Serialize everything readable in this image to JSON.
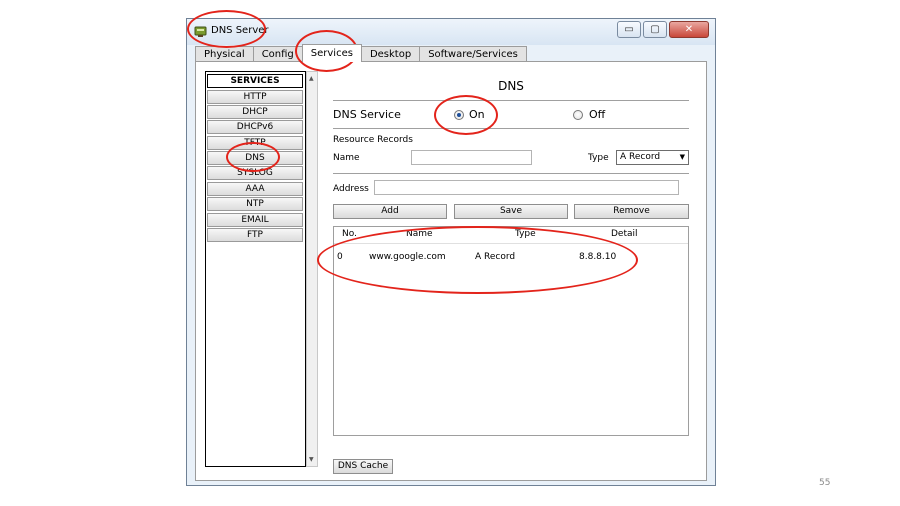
{
  "window": {
    "title": "DNS Server",
    "controls": {
      "minimize_glyph": "▭",
      "maximize_glyph": "▢",
      "close_glyph": "✕"
    }
  },
  "tabs": [
    {
      "label": "Physical"
    },
    {
      "label": "Config"
    },
    {
      "label": "Services",
      "active": true
    },
    {
      "label": "Desktop"
    },
    {
      "label": "Software/Services"
    }
  ],
  "services": {
    "heading": "SERVICES",
    "items": [
      "HTTP",
      "DHCP",
      "DHCPv6",
      "TFTP",
      "DNS",
      "SYSLOG",
      "AAA",
      "NTP",
      "EMAIL",
      "FTP"
    ],
    "selected": "DNS"
  },
  "dns": {
    "title": "DNS",
    "service_label": "DNS Service",
    "on_label": "On",
    "off_label": "Off",
    "service_state": "On",
    "records_label": "Resource Records",
    "name_label": "Name",
    "name_value": "",
    "type_label": "Type",
    "type_value": "A Record",
    "address_label": "Address",
    "address_value": "",
    "add_button": "Add",
    "save_button": "Save",
    "remove_button": "Remove",
    "cache_button": "DNS Cache",
    "table": {
      "columns": [
        "No.",
        "Name",
        "Type",
        "Detail"
      ],
      "rows": [
        {
          "no": "0",
          "name": "www.google.com",
          "type": "A Record",
          "detail": "8.8.8.10"
        }
      ]
    }
  },
  "slide": {
    "page_number": "55"
  },
  "colors": {
    "annotation_red": "#e3241b",
    "window_frame": "#e9f1f9",
    "radio_dot": "#1e4f9a"
  }
}
